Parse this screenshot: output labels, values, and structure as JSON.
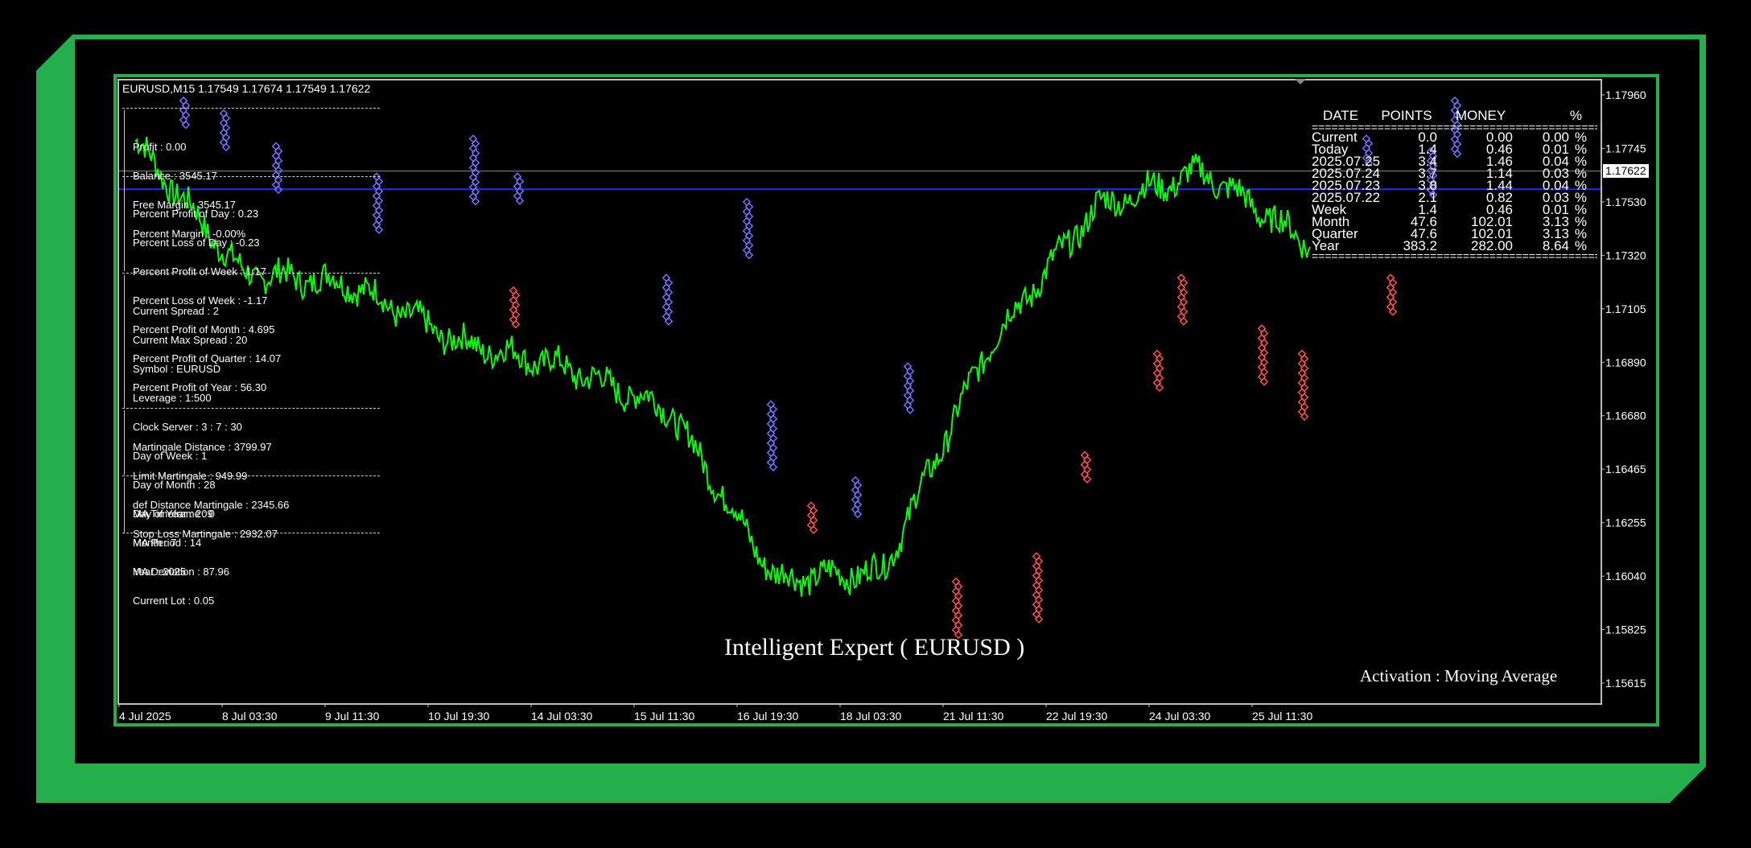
{
  "window": {
    "symbol_line": "EURUSD,M15  1.17549 1.17674 1.17549 1.17622"
  },
  "colors": {
    "frame": "#23b04c",
    "price_line": "#00ff00",
    "buy_marker": "#6f72ff",
    "sell_marker": "#ff4d4d",
    "level_line": "#1f2bff"
  },
  "account": {
    "profit": "Profit : 0.00",
    "balance": "Balance : 3545.17",
    "free_margin": "Free Margin : 3545.17",
    "percent_margin": "Percent Margin : -0.00%"
  },
  "performance": {
    "pp_day": "Percent Profit of Day : 0.23",
    "pl_day": "Percent Loss of Day : -0.23",
    "pp_week": "Percent Profit of Week : 1.17",
    "pl_week": "Percent Loss of Week : -1.17",
    "pp_month": "Percent Profit of Month : 4.695",
    "pp_quarter": "Percent Profit of Quarter : 14.07",
    "pp_year": "Percent Profit of Year : 56.30"
  },
  "market": {
    "spread": "Current Spread : 2",
    "max_spread": "Current Max Spread : 20",
    "symbol": "Symbol : EURUSD",
    "leverage": "Leverage : 1:500",
    "clock": "Clock Server : 3 : 7 : 30",
    "dow": "Day of Week : 1",
    "dom": "Day of Month : 28",
    "doy": "Day of Year : 209",
    "month": "Month : 7",
    "year": "Year : 2025",
    "lot": "Current Lot : 0.05"
  },
  "martingale": {
    "distance": "Martingale Distance : 3799.97",
    "limit": "Limit Martingale : 949.99",
    "def_distance": "def Distance Martingale : 2345.66",
    "stop_loss": "Stop Loss Martingale : 2932.07"
  },
  "ma": {
    "timeframe": "MA Timeframe : 0",
    "period": "MA Period : 14",
    "deviation": "MA Deviation : 87.96"
  },
  "stats_table": {
    "headers": [
      "DATE",
      "POINTS",
      "MONEY",
      "%"
    ],
    "rows": [
      [
        "Current",
        "0.0",
        "0.00",
        "0.00",
        "%"
      ],
      [
        "Today",
        "1.4",
        "0.46",
        "0.01",
        "%"
      ],
      [
        "2025.07.25",
        "3.4",
        "1.46",
        "0.04",
        "%"
      ],
      [
        "2025.07.24",
        "3.7",
        "1.14",
        "0.03",
        "%"
      ],
      [
        "2025.07.23",
        "3.8",
        "1.44",
        "0.04",
        "%"
      ],
      [
        "2025.07.22",
        "2.1",
        "0.82",
        "0.03",
        "%"
      ],
      [
        "Week",
        "1.4",
        "0.46",
        "0.01",
        "%"
      ],
      [
        "Month",
        "47.6",
        "102.01",
        "3.13",
        "%"
      ],
      [
        "Quarter",
        "47.6",
        "102.01",
        "3.13",
        "%"
      ],
      [
        "Year",
        "383.2",
        "282.00",
        "8.64",
        "%"
      ]
    ]
  },
  "overlay": {
    "title": "Intelligent Expert  ( EURUSD )",
    "activation": "Activation : Moving Average"
  },
  "price_axis": {
    "labels": [
      "1.17960",
      "1.17745",
      "1.17530",
      "1.17320",
      "1.17105",
      "1.16890",
      "1.16680",
      "1.16465",
      "1.16255",
      "1.16040",
      "1.15825",
      "1.15615"
    ],
    "current": "1.17622"
  },
  "time_axis": {
    "labels": [
      "4 Jul 2025",
      "8 Jul 03:30",
      "9 Jul 11:30",
      "10 Jul 19:30",
      "14 Jul 03:30",
      "15 Jul 11:30",
      "16 Jul 19:30",
      "18 Jul 03:30",
      "21 Jul 11:30",
      "22 Jul 19:30",
      "24 Jul 03:30",
      "25 Jul 11:30"
    ]
  },
  "chart_data": {
    "type": "line",
    "title": "",
    "series": [
      {
        "x": [
          "4 Jul 2025",
          "8 Jul 03:30",
          "9 Jul 11:30",
          "10 Jul 19:30",
          "14 Jul 03:30",
          "15 Jul 11:30",
          "16 Jul 19:30",
          "18 Jul 03:30",
          "21 Jul 11:30",
          "22 Jul 19:30",
          "24 Jul 03:30",
          "25 Jul 11:30"
        ],
        "y": [
          1.1774,
          1.1722,
          1.1718,
          1.1695,
          1.1685,
          1.1668,
          1.1601,
          1.1604,
          1.1694,
          1.1748,
          1.1762,
          1.1733
        ]
      }
    ],
    "ylim": [
      1.1552,
      1.1798
    ],
    "current_price": 1.17622,
    "level_price": 1.1755,
    "grid": false
  }
}
